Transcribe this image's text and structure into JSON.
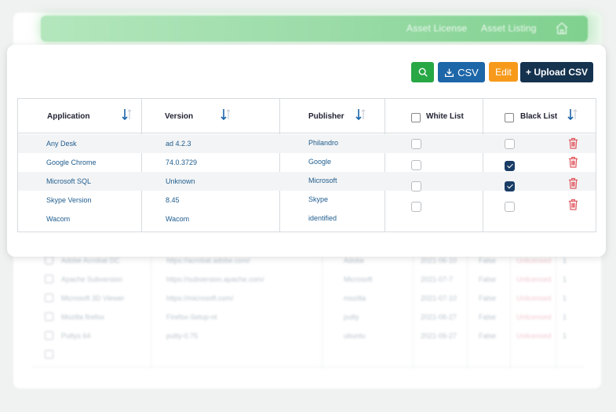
{
  "nav": {
    "asset_license": "Asset License",
    "asset_listing": "Asset Listing",
    "home_icon": "home-icon"
  },
  "toolbar": {
    "search_icon": "search-icon",
    "csv_label": "CSV",
    "download_icon": "download-icon",
    "edit_label": "Edit",
    "upload_label": "+ Upload CSV"
  },
  "table": {
    "headers": {
      "application": "Application",
      "version": "Version",
      "publisher": "Publisher",
      "white_list": "White List",
      "black_list": "Black List"
    },
    "rows": [
      {
        "application": "Any Desk",
        "version": "ad 4.2.3",
        "publisher": "Philandro",
        "white": false,
        "black": false
      },
      {
        "application": "Google Chrome",
        "version": "74.0.3729",
        "publisher": "Google",
        "white": false,
        "black": true
      },
      {
        "application": "Microsoft SQL",
        "version": "Unknown",
        "publisher": "Microsoft",
        "white": false,
        "black": true
      },
      {
        "application": "Skype Version",
        "version": "8.45",
        "publisher": "Skype",
        "white": false,
        "black": false
      },
      {
        "application": "Wacom",
        "version": "Wacom",
        "publisher": "identified",
        "white": null,
        "black": null
      }
    ]
  },
  "background_rows": [
    {
      "name": "Adobe Acrobat DC",
      "url": "https://acrobat.adobe.com/",
      "publisher": "Adobe",
      "date": "2021-06-10",
      "flag": "False",
      "status": "Unlicensed",
      "count": "1"
    },
    {
      "name": "Apache Subversion",
      "url": "https://subversion.apache.com/",
      "publisher": "Microsoft",
      "date": "2021-07-7",
      "flag": "False",
      "status": "Unlicensed",
      "count": "1"
    },
    {
      "name": "Microsoft 3D Viewer",
      "url": "https://microsoft.com/",
      "publisher": "mozilla",
      "date": "2021-07-10",
      "flag": "False",
      "status": "Unlicensed",
      "count": "1"
    },
    {
      "name": "Mozilla firefox",
      "url": "Firefox-Setup-nt",
      "publisher": "putty",
      "date": "2021-06-27",
      "flag": "False",
      "status": "Unlicensed",
      "count": "1"
    },
    {
      "name": "Puttys 64",
      "url": "putty-0.75",
      "publisher": "ubuntu",
      "date": "2021-06-27",
      "flag": "False",
      "status": "Unlicensed",
      "count": "1"
    }
  ],
  "colors": {
    "search": "#28a745",
    "csv": "#1d66a8",
    "edit": "#f79a1b",
    "upload": "#15324f",
    "checked": "#1a3d66",
    "trash": "#e0585f"
  }
}
